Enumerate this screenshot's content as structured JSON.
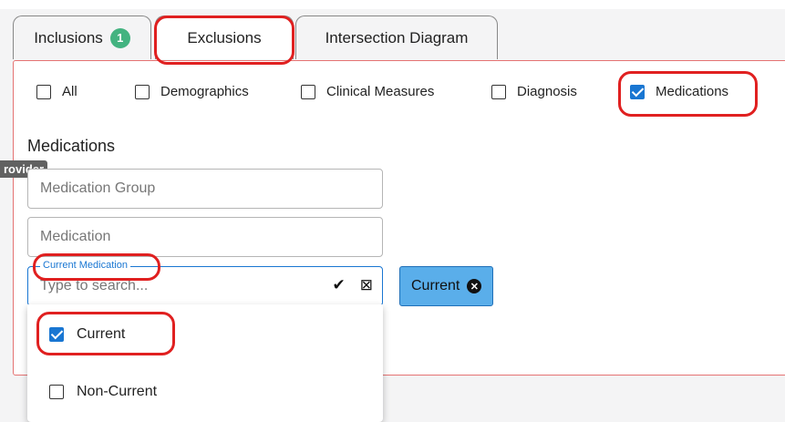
{
  "tabs": [
    {
      "label": "Inclusions",
      "badge": "1"
    },
    {
      "label": "Exclusions"
    },
    {
      "label": "Intersection Diagram"
    }
  ],
  "filters": [
    {
      "label": "All",
      "checked": false
    },
    {
      "label": "Demographics",
      "checked": false
    },
    {
      "label": "Clinical Measures",
      "checked": false
    },
    {
      "label": "Diagnosis",
      "checked": false
    },
    {
      "label": "Medications",
      "checked": true
    }
  ],
  "section_title": "Medications",
  "tooltip": "rovider",
  "medication_group": {
    "placeholder": "Medication Group"
  },
  "medication": {
    "placeholder": "Medication"
  },
  "current_medication": {
    "label": "Current Medication",
    "placeholder": "Type to search...",
    "confirm_icon": "✔",
    "clear_icon": "⊠"
  },
  "chip": {
    "label": "Current"
  },
  "options": [
    {
      "label": "Current",
      "checked": true
    },
    {
      "label": "Non-Current",
      "checked": false
    }
  ],
  "colors": {
    "accent": "#1976d2",
    "annotation": "#e02020",
    "badge": "#43b380",
    "chip": "#5aaeea"
  }
}
